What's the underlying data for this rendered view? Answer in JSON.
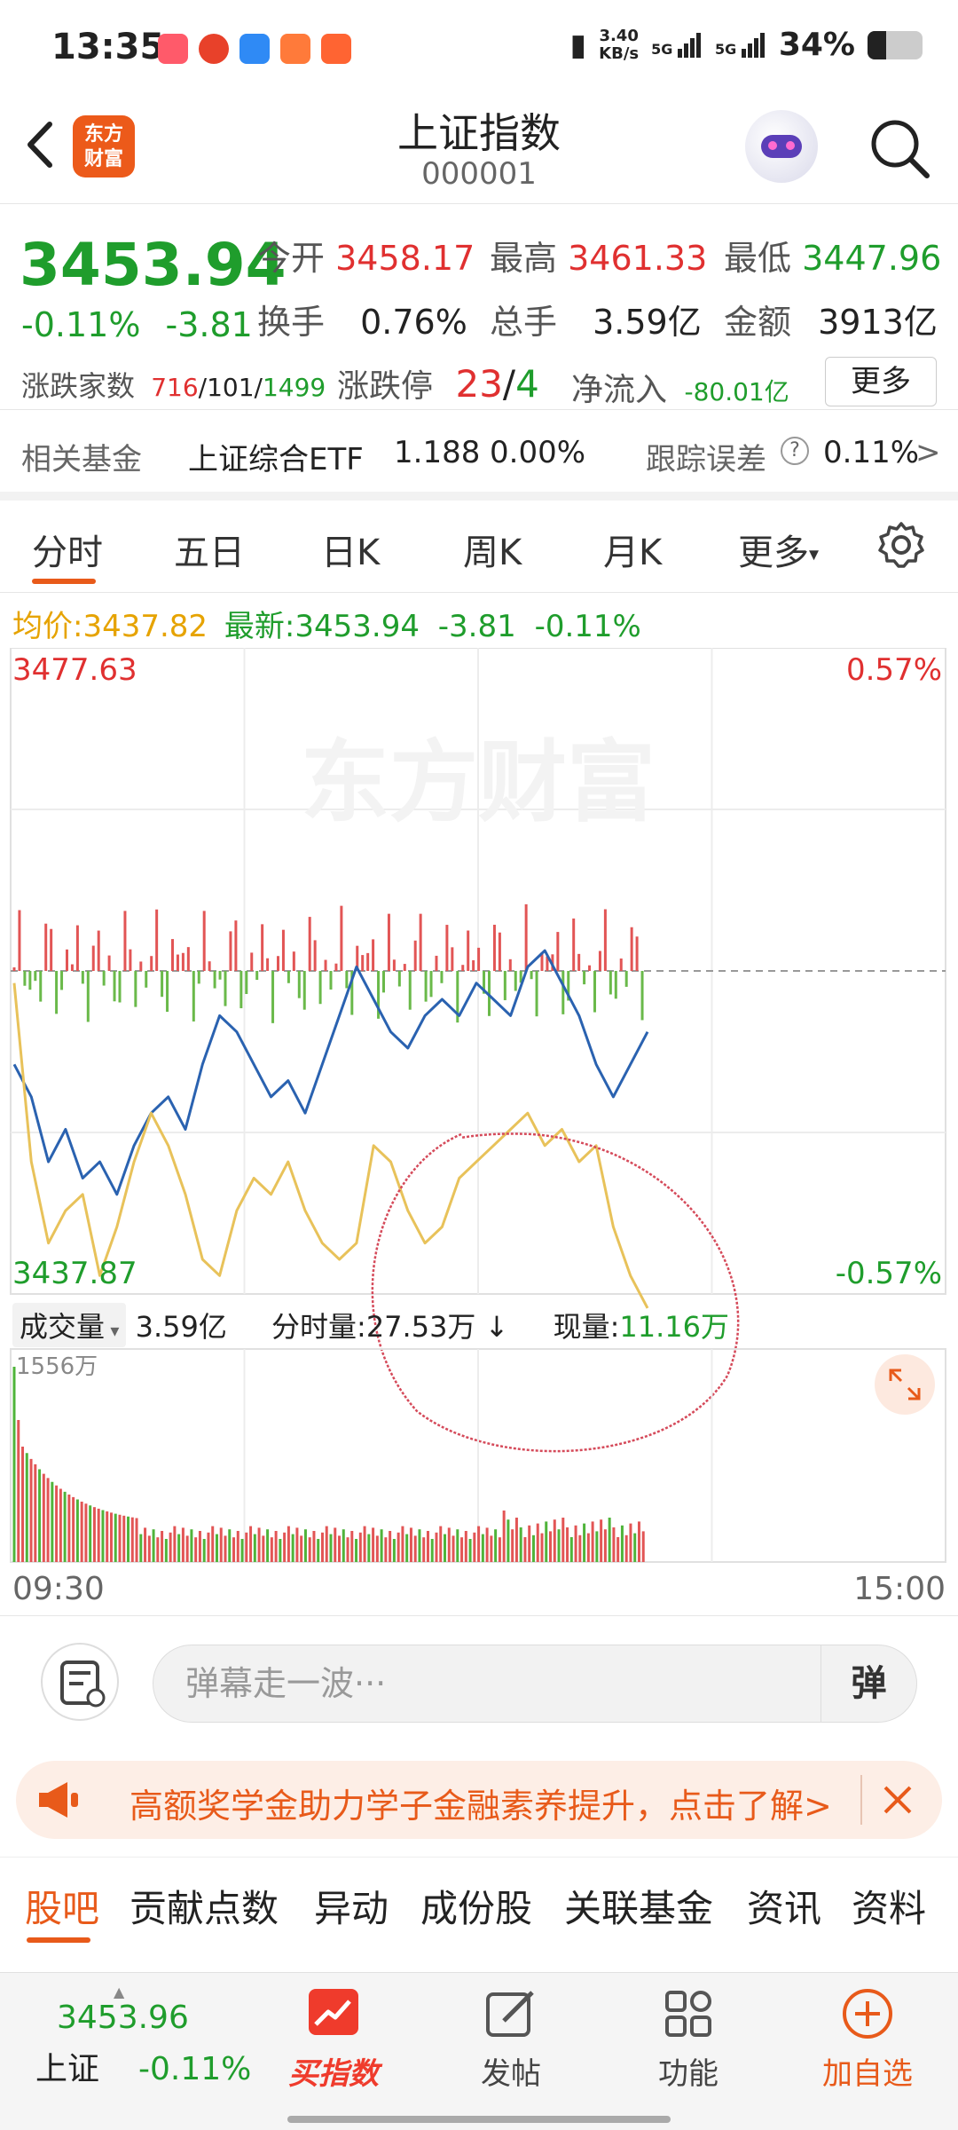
{
  "status": {
    "time": "13:35",
    "speed": "3.40",
    "speed_unit": "KB/s",
    "net1": "5G",
    "net2": "5G",
    "battery": "34%"
  },
  "header": {
    "title": "上证指数",
    "code": "000001",
    "logo_line1": "东方",
    "logo_line2": "财富"
  },
  "quote": {
    "price": "3453.94",
    "change_pct": "-0.11%",
    "change": "-3.81",
    "open_label": "今开",
    "open": "3458.17",
    "high_label": "最高",
    "high": "3461.33",
    "low_label": "最低",
    "low": "3447.96",
    "turnover_label": "换手",
    "turnover": "0.76%",
    "volume_label": "总手",
    "volume": "3.59亿",
    "amount_label": "金额",
    "amount": "3913亿",
    "breadth_label": "涨跌家数",
    "up": "716",
    "flat": "101",
    "down": "1499",
    "limit_label": "涨跌停",
    "limit_up": "23",
    "limit_down": "4",
    "inflow_label": "净流入",
    "inflow": "-80.01亿",
    "more": "更多"
  },
  "fund": {
    "label": "相关基金",
    "name": "上证综合ETF",
    "price": "1.188",
    "pct": "0.00%",
    "track_label": "跟踪误差",
    "track": "0.11%",
    "arrow": ">"
  },
  "tabs": [
    "分时",
    "五日",
    "日K",
    "周K",
    "月K",
    "更多"
  ],
  "info_line": {
    "avg_label": "均价:",
    "avg": "3437.82",
    "latest_label": "最新:",
    "latest": "3453.94",
    "chg": "-3.81",
    "pct": "-0.11%"
  },
  "chart_data": {
    "type": "line",
    "title": "",
    "ylim": [
      3437.87,
      3477.63
    ],
    "y_max_label": "3477.63",
    "y_min_label": "3437.87",
    "pct_max_label": "0.57%",
    "pct_min_label": "-0.57%",
    "watermark": "东方财富",
    "x_start": "09:30",
    "x_end": "15:00",
    "series": [
      {
        "values": [
          3452,
          3450,
          3446,
          3448,
          3445,
          3446,
          3444,
          3447,
          3449,
          3450,
          3448,
          3452,
          3455,
          3454,
          3452,
          3450,
          3451,
          3449,
          3452,
          3455,
          3458,
          3456,
          3454,
          3453,
          3455,
          3456,
          3455,
          3457,
          3456,
          3455,
          3458,
          3459,
          3457,
          3455,
          3452,
          3450,
          3452,
          3454
        ]
      },
      {
        "values": [
          3457,
          3446,
          3441,
          3443,
          3444,
          3439,
          3442,
          3446,
          3449,
          3447,
          3444,
          3440,
          3439,
          3443,
          3445,
          3444,
          3446,
          3443,
          3441,
          3440,
          3441,
          3447,
          3446,
          3443,
          3441,
          3442,
          3445,
          3446,
          3447,
          3448,
          3449,
          3447,
          3448,
          3446,
          3447,
          3442,
          3439,
          3437
        ]
      }
    ],
    "volume_max_label": "1556万"
  },
  "volume": {
    "label": "成交量",
    "total": "3.59亿",
    "minute": "分时量:27.53万 ↓",
    "now_label": "现量:",
    "now": "11.16万"
  },
  "input": {
    "placeholder": "弹幕走一波···",
    "danmu": "弹"
  },
  "banner": {
    "text": "高额奖学金助力学子金融素养提升，点击了解>"
  },
  "bottom_tabs": [
    "股吧",
    "贡献点数",
    "异动",
    "成份股",
    "关联基金",
    "资讯",
    "资料"
  ],
  "nav": {
    "price": "3453.96",
    "name": "上证",
    "pct": "-0.11%",
    "buy": "买指数",
    "post": "发帖",
    "func": "功能",
    "add": "加自选"
  }
}
